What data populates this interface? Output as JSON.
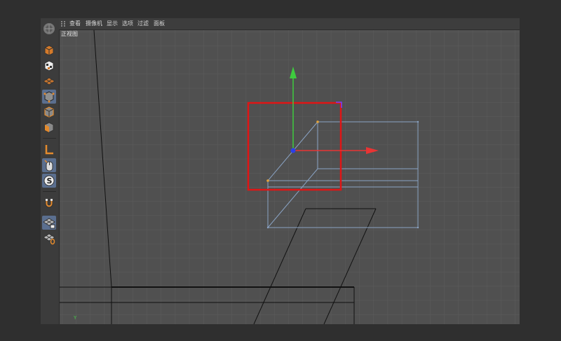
{
  "menubar": {
    "items": [
      {
        "label": "查看"
      },
      {
        "label": "摄像机"
      },
      {
        "label": "显示"
      },
      {
        "label": "选项"
      },
      {
        "label": "过滤"
      },
      {
        "label": "面板"
      }
    ]
  },
  "viewport": {
    "label": "正视图",
    "axis_label": "Y"
  },
  "toolbar": {
    "tools": [
      {
        "name": "cube-mode-icon",
        "active": false
      },
      {
        "name": "checker-texture-icon",
        "active": false
      },
      {
        "name": "polygon-grid-icon",
        "active": false
      },
      {
        "name": "cube-points-icon",
        "active": true
      },
      {
        "name": "cube-edges-icon",
        "active": false
      },
      {
        "name": "cube-faces-icon",
        "active": false
      },
      {
        "name": "axis-l-icon",
        "active": false
      },
      {
        "name": "mouse-tweak-icon",
        "active": true
      },
      {
        "name": "snap-s-icon",
        "active": true
      },
      {
        "name": "magnet-icon",
        "active": false
      },
      {
        "name": "grid-lock-icon",
        "active": true
      },
      {
        "name": "grid-workplane-icon",
        "active": false
      }
    ]
  },
  "colors": {
    "selection_box": "#e01515",
    "y_axis": "#3ecb3e",
    "x_axis": "#e83434",
    "z_handle": "#2c3fe8",
    "wireframe": "#8aa3c4"
  }
}
